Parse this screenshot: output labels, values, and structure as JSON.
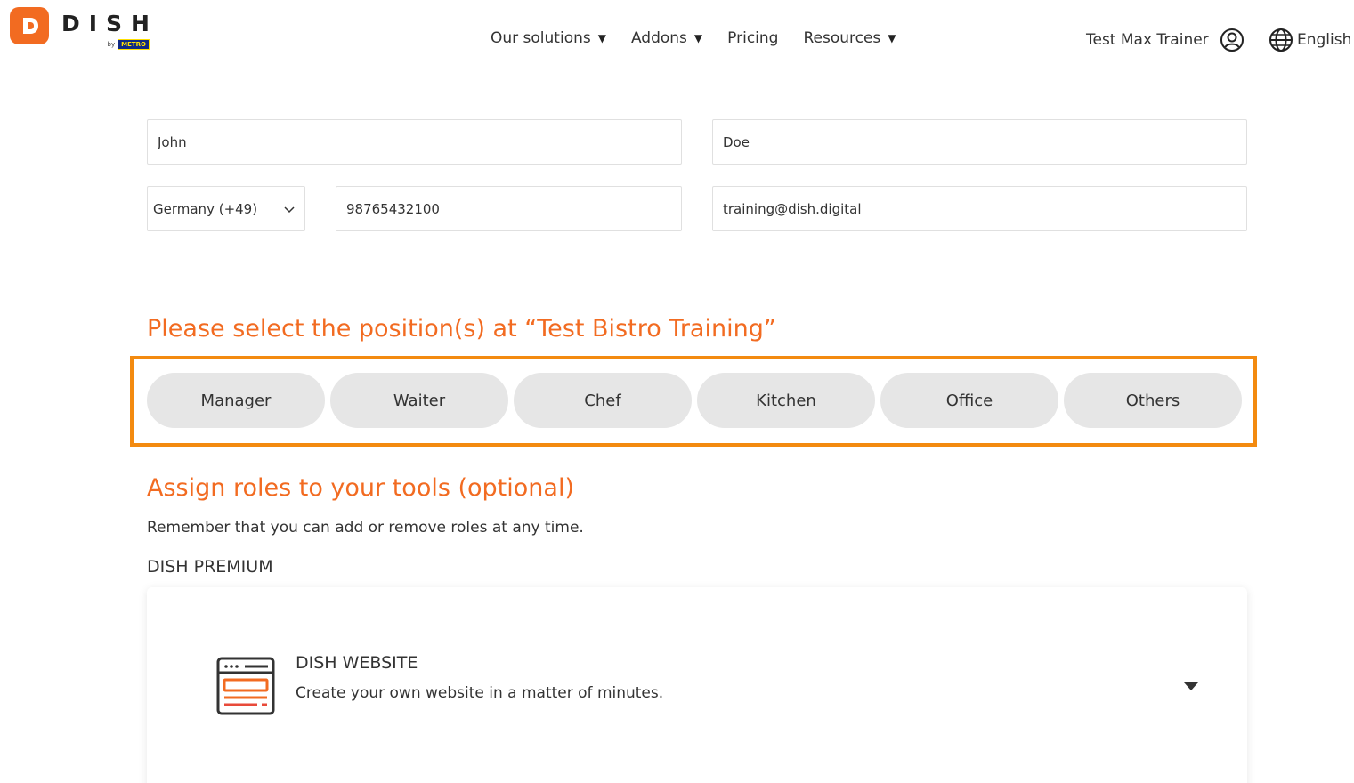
{
  "brand": {
    "name": "DISH",
    "by": "by",
    "metro": "METRO",
    "accent": "#f26b21"
  },
  "nav": [
    {
      "label": "Our solutions",
      "has_caret": true
    },
    {
      "label": "Addons",
      "has_caret": true
    },
    {
      "label": "Pricing",
      "has_caret": false
    },
    {
      "label": "Resources",
      "has_caret": true
    }
  ],
  "nav_caret": "▼",
  "user": {
    "name": "Test Max Trainer",
    "icon": "user-circle-icon"
  },
  "language": {
    "label": "English",
    "icon": "globe-icon"
  },
  "form": {
    "first_name": "John",
    "last_name": "Doe",
    "country_code": "Germany (+49)",
    "phone": "98765432100",
    "email": "training@dish.digital"
  },
  "positions": {
    "heading": "Please select the position(s) at “Test Bistro Training”",
    "highlight_color": "#f38a10",
    "options": [
      "Manager",
      "Waiter",
      "Chef",
      "Kitchen",
      "Office",
      "Others"
    ]
  },
  "roles": {
    "heading": "Assign roles to your tools (optional)",
    "description": "Remember that you can add or remove roles at any time.",
    "section_label": "DISH PREMIUM"
  },
  "tool_card": {
    "title": "DISH WEBSITE",
    "subtitle": "Create your own website in a matter of minutes.",
    "icon": "website-icon"
  }
}
